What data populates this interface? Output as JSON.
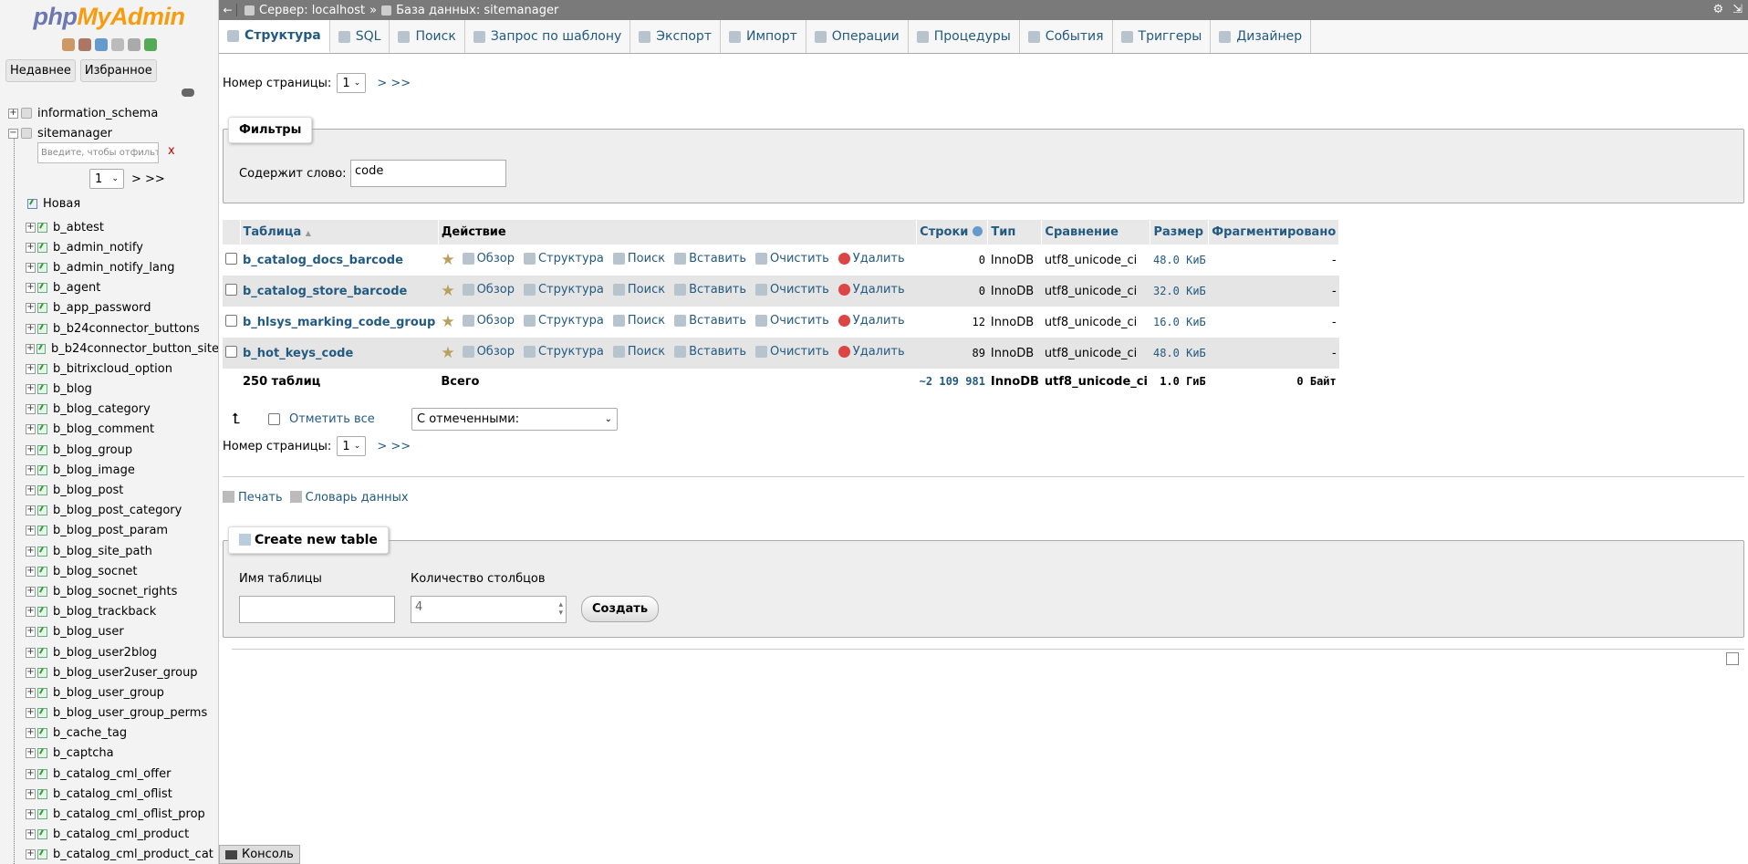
{
  "nav": {
    "logo_php": "php",
    "logo_myadmin": "MyAdmin",
    "tabs": [
      "Недавнее",
      "Избранное"
    ],
    "databases": [
      {
        "name": "information_schema",
        "state": "+"
      },
      {
        "name": "sitemanager",
        "state": "−"
      }
    ],
    "filter_placeholder": "Введите, чтобы отфильтровать",
    "filter_clear": "x",
    "pager_value": "1",
    "pager_arrows": "> >>",
    "new_label": "Новая",
    "tables": [
      "b_abtest",
      "b_admin_notify",
      "b_admin_notify_lang",
      "b_agent",
      "b_app_password",
      "b_b24connector_buttons",
      "b_b24connector_button_site",
      "b_bitrixcloud_option",
      "b_blog",
      "b_blog_category",
      "b_blog_comment",
      "b_blog_group",
      "b_blog_image",
      "b_blog_post",
      "b_blog_post_category",
      "b_blog_post_param",
      "b_blog_site_path",
      "b_blog_socnet",
      "b_blog_socnet_rights",
      "b_blog_trackback",
      "b_blog_user",
      "b_blog_user2blog",
      "b_blog_user2user_group",
      "b_blog_user_group",
      "b_blog_user_group_perms",
      "b_cache_tag",
      "b_captcha",
      "b_catalog_cml_offer",
      "b_catalog_cml_oflist",
      "b_catalog_cml_oflist_prop",
      "b_catalog_cml_product",
      "b_catalog_cml_product_cat"
    ]
  },
  "topbar": {
    "back": "←",
    "server": "Сервер: localhost",
    "sep": "»",
    "database": "База данных: sitemanager",
    "gear": "⚙",
    "close": "⇲"
  },
  "menu": [
    "Структура",
    "SQL",
    "Поиск",
    "Запрос по шаблону",
    "Экспорт",
    "Импорт",
    "Операции",
    "Процедуры",
    "События",
    "Триггеры",
    "Дизайнер"
  ],
  "pager": {
    "label": "Номер страницы:",
    "value": "1",
    "arrows": "> >>"
  },
  "filters": {
    "legend": "Фильтры",
    "label": "Содержит слово:",
    "value": "code"
  },
  "table": {
    "headers": {
      "table": "Таблица",
      "sort": "▲",
      "action": "Действие",
      "rows": "Строки",
      "type": "Тип",
      "collation": "Сравнение",
      "size": "Размер",
      "overhead": "Фрагментировано"
    },
    "actions": [
      "Обзор",
      "Структура",
      "Поиск",
      "Вставить",
      "Очистить",
      "Удалить"
    ],
    "rows": [
      {
        "name": "b_catalog_docs_barcode",
        "rows": "0",
        "type": "InnoDB",
        "collation": "utf8_unicode_ci",
        "size": "48.0 КиБ",
        "overhead": "-"
      },
      {
        "name": "b_catalog_store_barcode",
        "rows": "0",
        "type": "InnoDB",
        "collation": "utf8_unicode_ci",
        "size": "32.0 КиБ",
        "overhead": "-"
      },
      {
        "name": "b_hlsys_marking_code_group",
        "rows": "12",
        "type": "InnoDB",
        "collation": "utf8_unicode_ci",
        "size": "16.0 КиБ",
        "overhead": "-"
      },
      {
        "name": "b_hot_keys_code",
        "rows": "89",
        "type": "InnoDB",
        "collation": "utf8_unicode_ci",
        "size": "48.0 КиБ",
        "overhead": "-"
      }
    ],
    "total": {
      "count": "250 таблиц",
      "label": "Всего",
      "rows": "~2 109 981",
      "type": "InnoDB",
      "collation": "utf8_unicode_ci",
      "size": "1.0 ГиБ",
      "overhead": "0 Байт"
    }
  },
  "bulk": {
    "check_all": "Отметить все",
    "with_selected": "С отмеченными:"
  },
  "links": {
    "print": "Печать",
    "dictionary": "Словарь данных"
  },
  "create": {
    "legend": "Create new table",
    "name_label": "Имя таблицы",
    "name_value": "",
    "cols_label": "Количество столбцов",
    "cols_value": "4",
    "button": "Создать"
  },
  "console": "Консоль"
}
